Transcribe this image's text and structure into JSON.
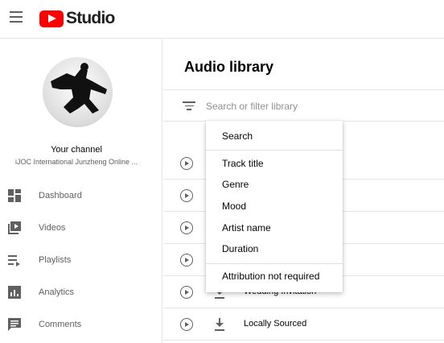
{
  "header": {
    "brand": "Studio"
  },
  "sidebar": {
    "channel_title": "Your channel",
    "channel_name": "iJOC International Junzheng Online ...",
    "items": [
      {
        "label": "Dashboard",
        "icon": "dashboard-icon"
      },
      {
        "label": "Videos",
        "icon": "videos-icon"
      },
      {
        "label": "Playlists",
        "icon": "playlists-icon"
      },
      {
        "label": "Analytics",
        "icon": "analytics-icon"
      },
      {
        "label": "Comments",
        "icon": "comments-icon"
      }
    ]
  },
  "main": {
    "title": "Audio library",
    "filter": {
      "placeholder": "Search or filter library"
    },
    "rows": [
      {
        "track": ""
      },
      {
        "track": ""
      },
      {
        "track": ""
      },
      {
        "track": ""
      },
      {
        "track": "Wedding Invitation"
      },
      {
        "track": "Locally Sourced"
      }
    ]
  },
  "dropdown": {
    "items": [
      "Search",
      "Track title",
      "Genre",
      "Mood",
      "Artist name",
      "Duration",
      "Attribution not required"
    ]
  },
  "colors": {
    "brand_red": "#ff0000",
    "icon_gray": "#606060",
    "divider": "#e5e5e5"
  }
}
